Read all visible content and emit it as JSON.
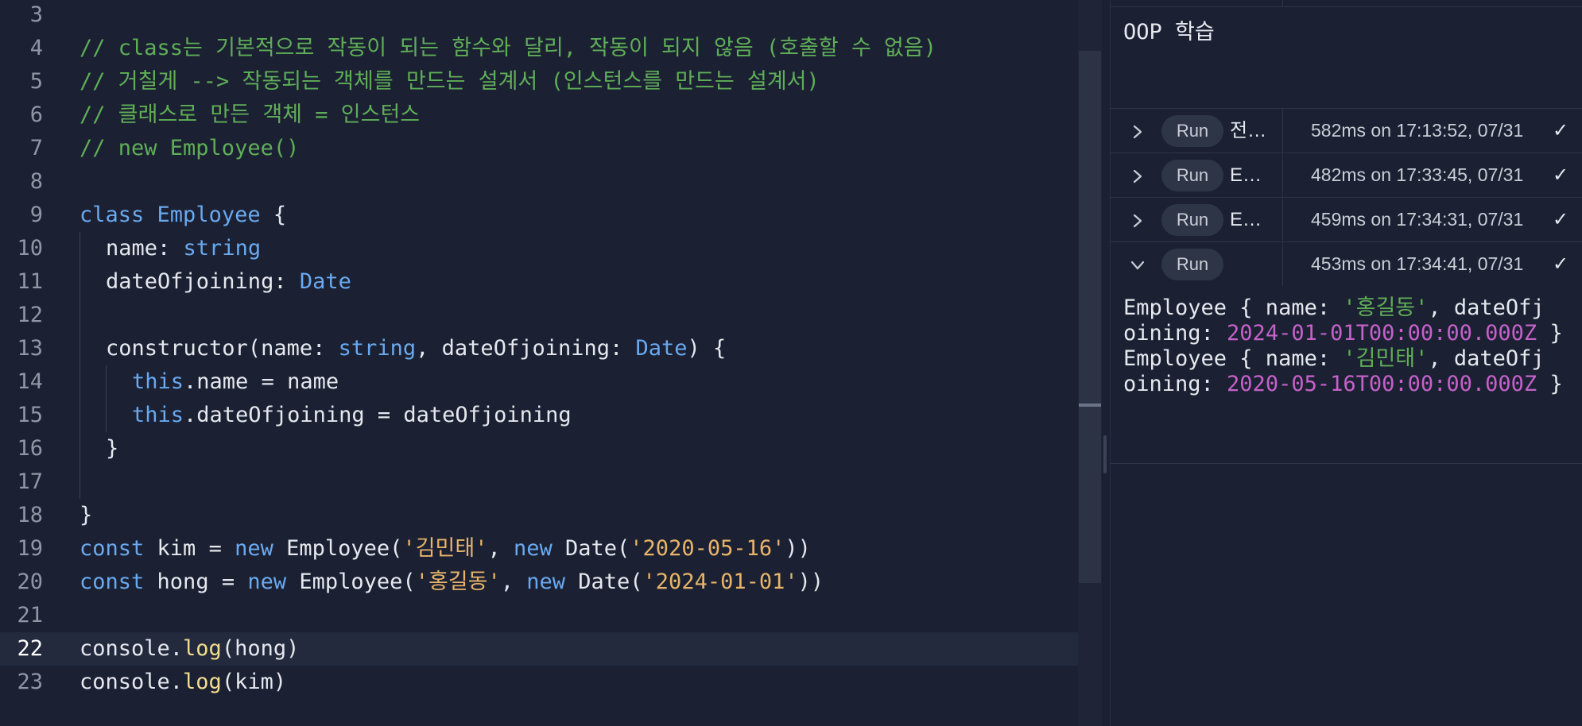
{
  "editor": {
    "lines": [
      {
        "num": "3"
      },
      {
        "num": "4",
        "parts": [
          {
            "t": "// class는 기본적으로 작동이 되는 함수와 달리, 작동이 되지 않음 (호출할 수 없음)",
            "c": "comment"
          }
        ]
      },
      {
        "num": "5",
        "parts": [
          {
            "t": "// 거칠게 --> 작동되는 객체를 만드는 설계서 (인스턴스를 만드는 설계서)",
            "c": "comment"
          }
        ]
      },
      {
        "num": "6",
        "parts": [
          {
            "t": "// 클래스로 만든 객체 = 인스턴스",
            "c": "comment"
          }
        ]
      },
      {
        "num": "7",
        "parts": [
          {
            "t": "// new Employee()",
            "c": "comment"
          }
        ]
      },
      {
        "num": "8"
      },
      {
        "num": "9",
        "parts": [
          {
            "t": "class ",
            "c": "kw"
          },
          {
            "t": "Employee",
            "c": "type"
          },
          {
            "t": " {",
            "c": "plain"
          }
        ]
      },
      {
        "num": "10",
        "indent": 1,
        "parts": [
          {
            "t": "name: ",
            "c": "plain"
          },
          {
            "t": "string",
            "c": "type"
          }
        ]
      },
      {
        "num": "11",
        "indent": 1,
        "parts": [
          {
            "t": "dateOfjoining: ",
            "c": "plain"
          },
          {
            "t": "Date",
            "c": "type"
          }
        ]
      },
      {
        "num": "12",
        "indent": 1
      },
      {
        "num": "13",
        "indent": 1,
        "parts": [
          {
            "t": "constructor(name: ",
            "c": "plain"
          },
          {
            "t": "string",
            "c": "type"
          },
          {
            "t": ", dateOfjoining: ",
            "c": "plain"
          },
          {
            "t": "Date",
            "c": "type"
          },
          {
            "t": ") {",
            "c": "plain"
          }
        ]
      },
      {
        "num": "14",
        "indent": 2,
        "parts": [
          {
            "t": "this",
            "c": "kw"
          },
          {
            "t": ".name = name",
            "c": "plain"
          }
        ]
      },
      {
        "num": "15",
        "indent": 2,
        "parts": [
          {
            "t": "this",
            "c": "kw"
          },
          {
            "t": ".dateOfjoining = dateOfjoining",
            "c": "plain"
          }
        ]
      },
      {
        "num": "16",
        "indent": 1,
        "parts": [
          {
            "t": "}",
            "c": "plain"
          }
        ]
      },
      {
        "num": "17",
        "indent": 1
      },
      {
        "num": "18",
        "parts": [
          {
            "t": "}",
            "c": "plain"
          }
        ]
      },
      {
        "num": "19",
        "parts": [
          {
            "t": "const ",
            "c": "kw"
          },
          {
            "t": "kim = ",
            "c": "plain"
          },
          {
            "t": "new ",
            "c": "kw"
          },
          {
            "t": "Employee(",
            "c": "plain"
          },
          {
            "t": "'김민태'",
            "c": "str"
          },
          {
            "t": ", ",
            "c": "plain"
          },
          {
            "t": "new ",
            "c": "kw"
          },
          {
            "t": "Date(",
            "c": "plain"
          },
          {
            "t": "'2020-05-16'",
            "c": "str"
          },
          {
            "t": "))",
            "c": "plain"
          }
        ]
      },
      {
        "num": "20",
        "parts": [
          {
            "t": "const ",
            "c": "kw"
          },
          {
            "t": "hong = ",
            "c": "plain"
          },
          {
            "t": "new ",
            "c": "kw"
          },
          {
            "t": "Employee(",
            "c": "plain"
          },
          {
            "t": "'홍길동'",
            "c": "str"
          },
          {
            "t": ", ",
            "c": "plain"
          },
          {
            "t": "new ",
            "c": "kw"
          },
          {
            "t": "Date(",
            "c": "plain"
          },
          {
            "t": "'2024-01-01'",
            "c": "str"
          },
          {
            "t": "))",
            "c": "plain"
          }
        ]
      },
      {
        "num": "21"
      },
      {
        "num": "22",
        "active": true,
        "parts": [
          {
            "t": "console.",
            "c": "plain"
          },
          {
            "t": "log",
            "c": "fn"
          },
          {
            "t": "(hong)",
            "c": "plain"
          }
        ]
      },
      {
        "num": "23",
        "parts": [
          {
            "t": "console.",
            "c": "plain"
          },
          {
            "t": "log",
            "c": "fn"
          },
          {
            "t": "(kim)",
            "c": "plain"
          }
        ]
      }
    ]
  },
  "panel": {
    "title": "OOP 학습",
    "run_label": "Run",
    "runs": [
      {
        "expanded": false,
        "name": "전…",
        "meta": "582ms on 17:13:52, 07/31",
        "status": "✓"
      },
      {
        "expanded": false,
        "name": "E…",
        "meta": "482ms on 17:33:45, 07/31",
        "status": "✓"
      },
      {
        "expanded": false,
        "name": "E…",
        "meta": "459ms on 17:34:31, 07/31",
        "status": "✓"
      },
      {
        "expanded": true,
        "name": "",
        "meta": "453ms on 17:34:41, 07/31",
        "status": "✓"
      }
    ],
    "output": [
      {
        "prefix": "Employee { name: ",
        "name": "'홍길동'",
        "mid": ", dateOfj",
        "mid2": "oining: ",
        "date": "2024-01-01T00:00:00.000Z",
        "suffix": " }"
      },
      {
        "prefix": "Employee { name: ",
        "name": "'김민태'",
        "mid": ", dateOfj",
        "mid2": "oining: ",
        "date": "2020-05-16T00:00:00.000Z",
        "suffix": " }"
      }
    ]
  },
  "icons": {
    "collapsed": "chevron-right-icon",
    "expanded": "chevron-down-icon",
    "status": "check-icon"
  }
}
